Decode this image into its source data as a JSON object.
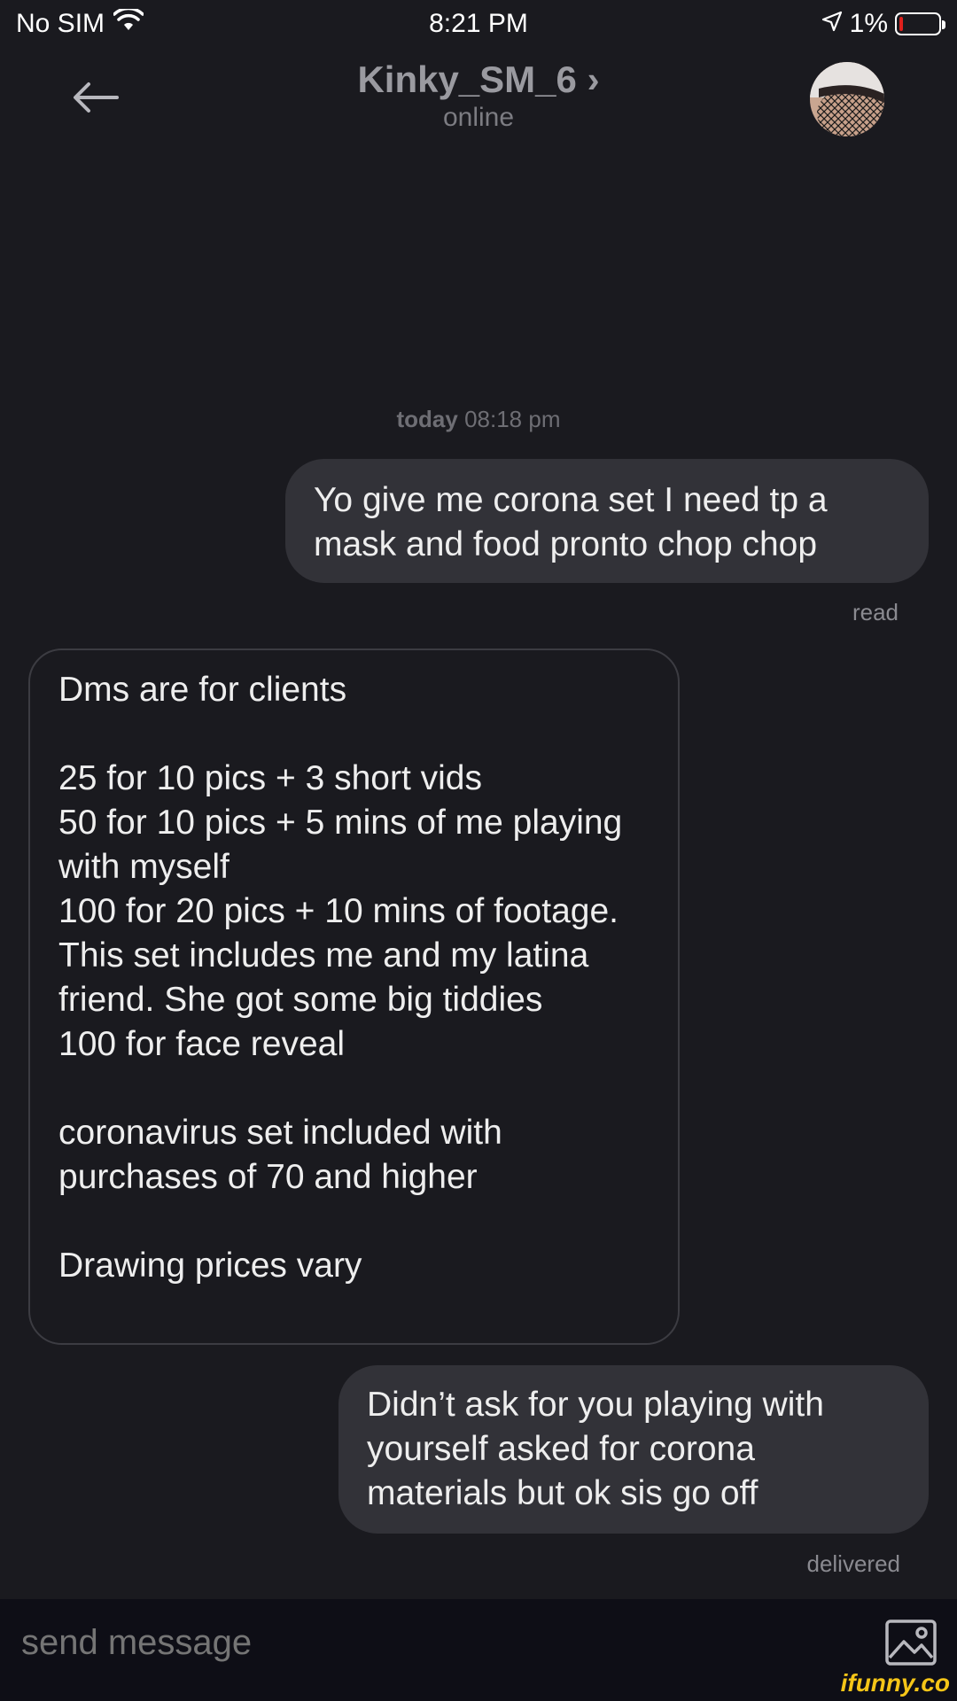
{
  "status_bar": {
    "carrier": "No SIM",
    "time": "8:21 PM",
    "battery_percent": "1%",
    "icons": [
      "wifi-icon",
      "location-icon",
      "battery-icon"
    ]
  },
  "header": {
    "title": "Kinky_SM_6",
    "title_chevron": "›",
    "subtitle": "online",
    "icons": [
      "back-arrow-icon",
      "avatar"
    ]
  },
  "conversation": {
    "timestamp_day": "today",
    "timestamp_time": "08:18 pm",
    "messages": [
      {
        "direction": "outgoing",
        "text": "Yo give me corona set I need tp a mask and food pronto chop chop",
        "receipt": "read"
      },
      {
        "direction": "incoming",
        "text": "Dms are for clients\n\n25 for 10 pics + 3 short vids\n50 for 10 pics + 5 mins of me playing with myself\n100 for 20 pics + 10 mins of footage. This set includes me and my latina friend. She got some big tiddies\n100 for face reveal\n\ncoronavirus set included with purchases of 70 and higher\n\nDrawing prices vary"
      },
      {
        "direction": "outgoing",
        "text": "Didn’t ask for you playing with yourself asked for corona materials but ok sis go off",
        "receipt": "delivered"
      }
    ]
  },
  "composer": {
    "placeholder": "send message",
    "icons": [
      "image-icon"
    ]
  },
  "watermark": "ifunny.co",
  "colors": {
    "background": "#1a1a1f",
    "outgoing_bubble": "#323238",
    "incoming_border": "#3c3c42",
    "composer_bg": "#0e0e16",
    "battery_low": "#e0201c",
    "watermark": "#f5c518"
  }
}
